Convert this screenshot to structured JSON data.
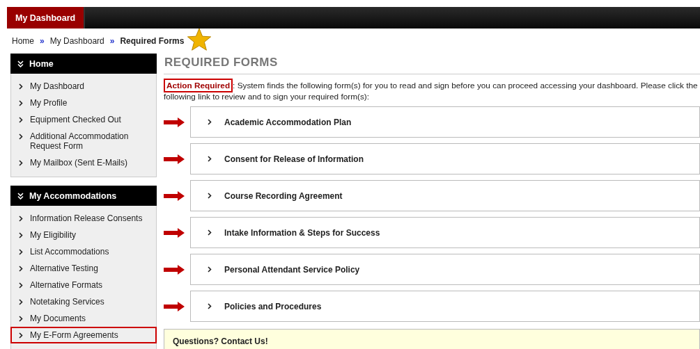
{
  "top_nav": {
    "tabs": [
      {
        "label": "My Dashboard",
        "selected": true
      }
    ]
  },
  "breadcrumb": {
    "items": [
      {
        "label": "Home",
        "current": false
      },
      {
        "label": "My Dashboard",
        "current": false
      },
      {
        "label": "Required Forms",
        "current": true
      }
    ],
    "separator": "»"
  },
  "sidebar": {
    "sections": [
      {
        "title": "Home",
        "items": [
          {
            "label": "My Dashboard",
            "highlighted": false
          },
          {
            "label": "My Profile",
            "highlighted": false
          },
          {
            "label": "Equipment Checked Out",
            "highlighted": false
          },
          {
            "label": "Additional Accommodation Request Form",
            "highlighted": false
          },
          {
            "label": "My Mailbox (Sent E-Mails)",
            "highlighted": false
          }
        ]
      },
      {
        "title": "My Accommodations",
        "items": [
          {
            "label": "Information Release Consents",
            "highlighted": false
          },
          {
            "label": "My Eligibility",
            "highlighted": false
          },
          {
            "label": "List Accommodations",
            "highlighted": false
          },
          {
            "label": "Alternative Testing",
            "highlighted": false
          },
          {
            "label": "Alternative Formats",
            "highlighted": false
          },
          {
            "label": "Notetaking Services",
            "highlighted": false
          },
          {
            "label": "My Documents",
            "highlighted": false
          },
          {
            "label": "My E-Form Agreements",
            "highlighted": true
          }
        ]
      }
    ]
  },
  "main": {
    "title": "REQUIRED FORMS",
    "notice": {
      "label": "Action Required",
      "label_highlighted": true,
      "text": ": System finds the following form(s) for you to read and sign before you can proceed accessing your dashboard. Please click the following link to review and to sign your required form(s):"
    },
    "forms": [
      {
        "title": "Academic Accommodation Plan"
      },
      {
        "title": "Consent for Release of Information"
      },
      {
        "title": "Course Recording Agreement"
      },
      {
        "title": "Intake Information & Steps for Success"
      },
      {
        "title": "Personal Attendant Service Policy"
      },
      {
        "title": "Policies and Procedures"
      }
    ],
    "contact": {
      "title": "Questions? Contact Us!"
    }
  }
}
